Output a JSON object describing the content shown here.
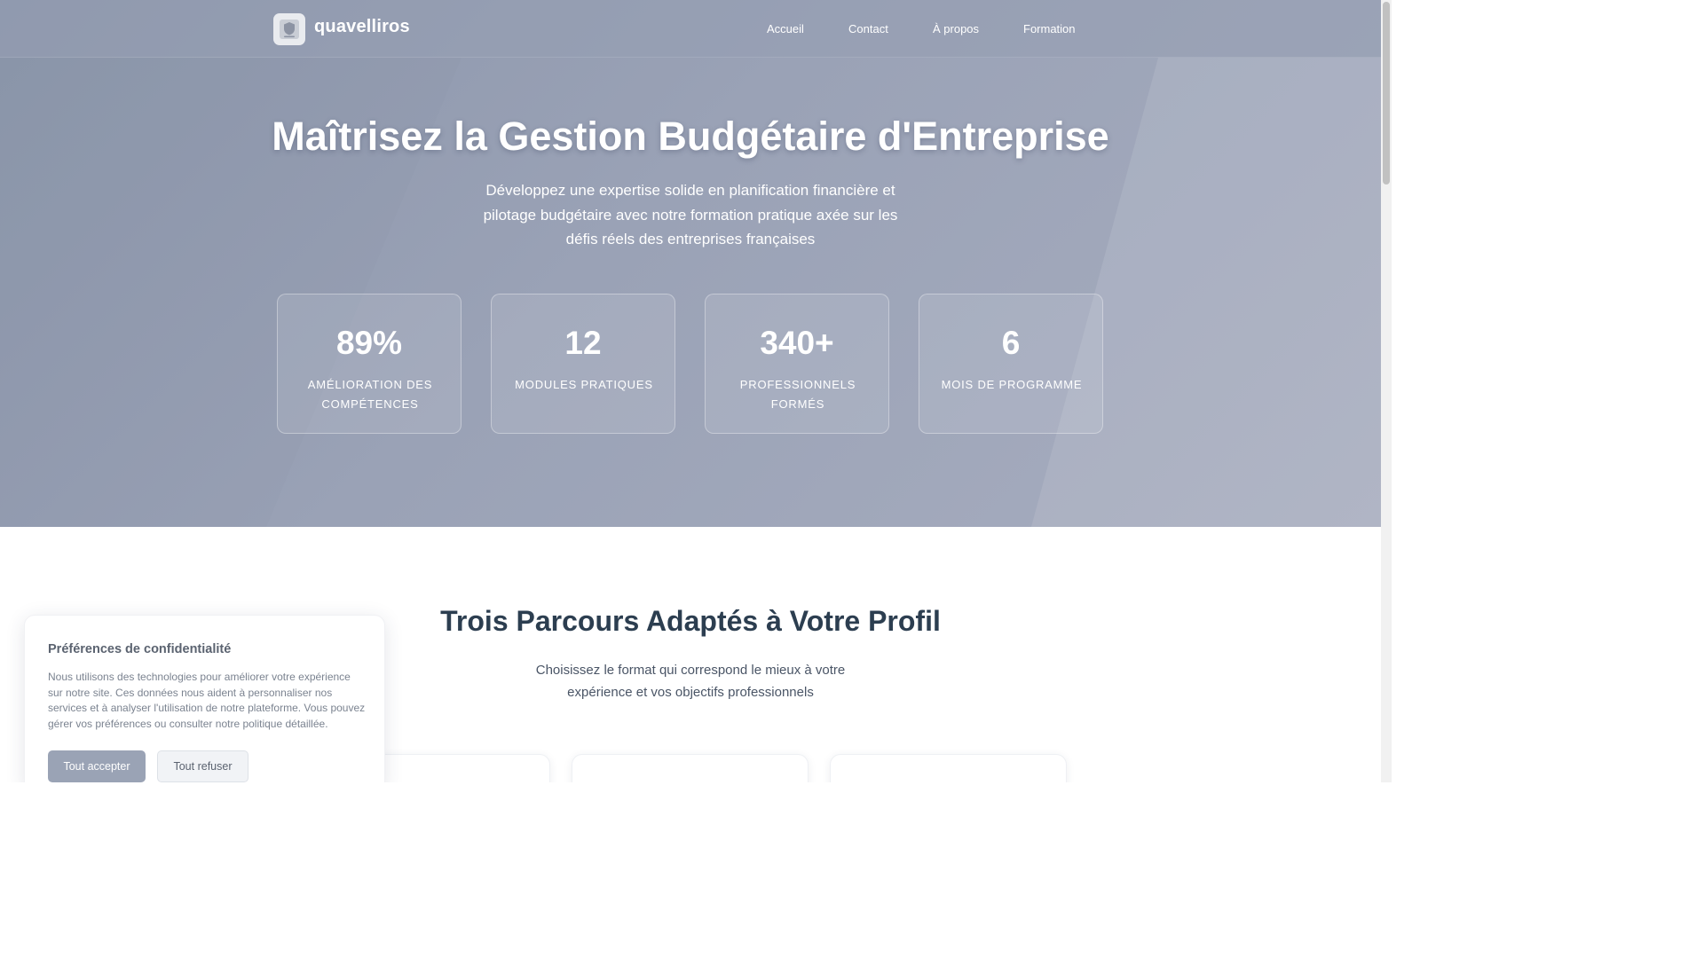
{
  "header": {
    "brand": "quavelliros",
    "nav": [
      "Accueil",
      "Contact",
      "À propos",
      "Formation"
    ]
  },
  "hero": {
    "title": "Maîtrisez la Gestion Budgétaire d'Entreprise",
    "subtitle": "Développez une expertise solide en planification financière et pilotage budgétaire avec notre formation pratique axée sur les défis réels des entreprises françaises"
  },
  "stats": [
    {
      "value": "89%",
      "label": "AMÉLIORATION DES COMPÉTENCES"
    },
    {
      "value": "12",
      "label": "MODULES PRATIQUES"
    },
    {
      "value": "340+",
      "label": "PROFESSIONNELS FORMÉS"
    },
    {
      "value": "6",
      "label": "MOIS DE PROGRAMME"
    }
  ],
  "section": {
    "title": "Trois Parcours Adaptés à Votre Profil",
    "subtitle": "Choisissez le format qui correspond le mieux à votre expérience et vos objectifs professionnels"
  },
  "cookie": {
    "title": "Préférences de confidentialité",
    "text": "Nous utilisons des technologies pour améliorer votre expérience sur notre site. Ces données nous aident à personnaliser nos services et à analyser l'utilisation de notre plateforme. Vous pouvez gérer vos préférences ou consulter notre politique détaillée.",
    "accept": "Tout accepter",
    "refuse": "Tout refuser"
  },
  "colors": {
    "hero_bg": "#9aa2b6",
    "heading": "#2c3e50",
    "accept_button": "#9aa3b5"
  },
  "icons": {
    "logo": "shield-icon"
  }
}
